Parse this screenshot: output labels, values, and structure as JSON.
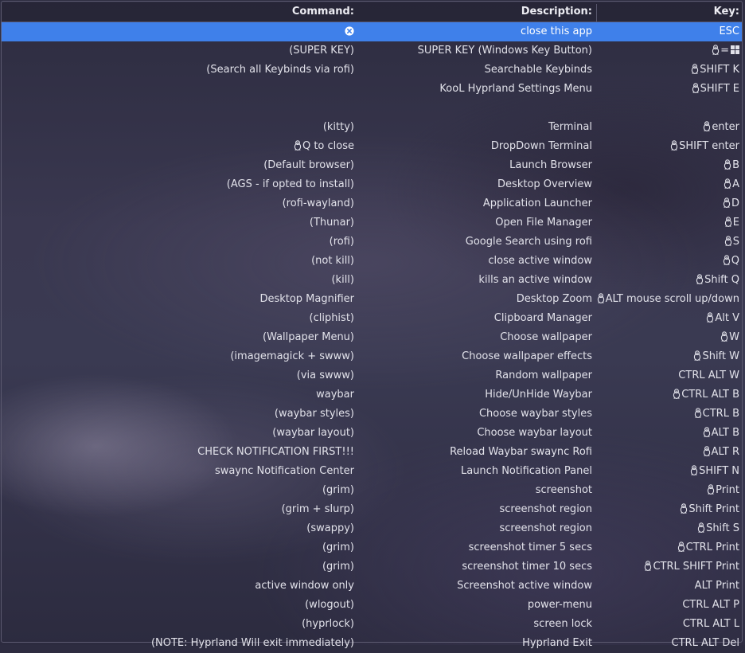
{
  "header": {
    "command": "Command:",
    "description": "Description:",
    "key": "Key:"
  },
  "rows": [
    {
      "cmd": "",
      "cmd_icon": "close-circle-icon",
      "desc": "close this app",
      "key": "ESC",
      "key_icon": "",
      "selected": true
    },
    {
      "cmd": "(SUPER KEY)",
      "desc": "SUPER KEY (Windows Key Button)",
      "key": "=",
      "key_icon": "tux-penguin-icon",
      "key_suffix_icon": "windows-logo-icon"
    },
    {
      "cmd": "(Search all Keybinds via rofi)",
      "desc": "Searchable Keybinds",
      "key": "SHIFT K",
      "key_icon": "tux-penguin-icon"
    },
    {
      "cmd": "",
      "desc": "KooL Hyprland Settings Menu",
      "key": "SHIFT E",
      "key_icon": "tux-penguin-icon"
    },
    {
      "cmd": "",
      "desc": "",
      "key": "",
      "key_icon": ""
    },
    {
      "cmd": "(kitty)",
      "desc": "Terminal",
      "key": "enter",
      "key_icon": "tux-penguin-icon"
    },
    {
      "cmd": "Q to close",
      "cmd_icon": "tux-penguin-icon",
      "desc": "DropDown Terminal",
      "key": "SHIFT enter",
      "key_icon": "tux-penguin-icon"
    },
    {
      "cmd": "(Default browser)",
      "desc": "Launch Browser",
      "key": "B",
      "key_icon": "tux-penguin-icon"
    },
    {
      "cmd": "(AGS - if opted to install)",
      "desc": "Desktop Overview",
      "key": "A",
      "key_icon": "tux-penguin-icon"
    },
    {
      "cmd": "(rofi-wayland)",
      "desc": "Application Launcher",
      "key": "D",
      "key_icon": "tux-penguin-icon"
    },
    {
      "cmd": "(Thunar)",
      "desc": "Open File Manager",
      "key": "E",
      "key_icon": "tux-penguin-icon"
    },
    {
      "cmd": "(rofi)",
      "desc": "Google Search using rofi",
      "key": "S",
      "key_icon": "tux-penguin-icon"
    },
    {
      "cmd": "(not kill)",
      "desc": "close active window",
      "key": "Q",
      "key_icon": "tux-penguin-icon"
    },
    {
      "cmd": "(kill)",
      "desc": "kills an active window",
      "key": "Shift Q ",
      "key_icon": "tux-penguin-icon"
    },
    {
      "cmd": "Desktop Magnifier",
      "desc": "Desktop Zoom",
      "key": "ALT mouse scroll up/down ",
      "key_icon": "tux-penguin-icon"
    },
    {
      "cmd": "(cliphist)",
      "desc": "Clipboard Manager",
      "key": "Alt V",
      "key_icon": "tux-penguin-icon"
    },
    {
      "cmd": "(Wallpaper Menu)",
      "desc": "Choose wallpaper",
      "key": "W",
      "key_icon": "tux-penguin-icon"
    },
    {
      "cmd": "(imagemagick + swww)",
      "desc": "Choose wallpaper effects",
      "key": "Shift W",
      "key_icon": "tux-penguin-icon"
    },
    {
      "cmd": "(via swww)",
      "desc": "Random wallpaper",
      "key": "CTRL ALT W",
      "key_icon": ""
    },
    {
      "cmd": "waybar",
      "desc": "Hide/UnHide Waybar",
      "key": "CTRL ALT B",
      "key_icon": "tux-penguin-icon"
    },
    {
      "cmd": "(waybar styles)",
      "desc": "Choose waybar styles",
      "key": "CTRL B",
      "key_icon": "tux-penguin-icon"
    },
    {
      "cmd": "(waybar layout)",
      "desc": "Choose waybar layout",
      "key": "ALT B",
      "key_icon": "tux-penguin-icon"
    },
    {
      "cmd": "CHECK NOTIFICATION FIRST!!!",
      "desc": "Reload Waybar swaync Rofi",
      "key": "ALT R",
      "key_icon": "tux-penguin-icon"
    },
    {
      "cmd": "swaync Notification Center",
      "desc": "Launch Notification Panel",
      "key": "SHIFT N",
      "key_icon": "tux-penguin-icon"
    },
    {
      "cmd": "(grim)",
      "desc": "screenshot",
      "key": "Print",
      "key_icon": "tux-penguin-icon"
    },
    {
      "cmd": "(grim + slurp)",
      "desc": "screenshot region",
      "key": "Shift Print",
      "key_icon": "tux-penguin-icon"
    },
    {
      "cmd": "(swappy)",
      "desc": "screenshot region",
      "key": "Shift S",
      "key_icon": "tux-penguin-icon"
    },
    {
      "cmd": "(grim)",
      "desc": "screenshot timer 5 secs ",
      "key": "CTRL Print",
      "key_icon": "tux-penguin-icon"
    },
    {
      "cmd": "(grim)",
      "desc": "screenshot timer 10 secs",
      "key": "CTRL SHIFT Print",
      "key_icon": "tux-penguin-icon"
    },
    {
      "cmd": "active window only",
      "desc": "Screenshot active window",
      "key": "ALT Print",
      "key_icon": ""
    },
    {
      "cmd": "(wlogout)",
      "desc": "power-menu",
      "key": "CTRL ALT P",
      "key_icon": ""
    },
    {
      "cmd": "(hyprlock)",
      "desc": "screen lock",
      "key": "CTRL ALT L",
      "key_icon": ""
    },
    {
      "cmd": "(NOTE: Hyprland Will exit immediately)",
      "desc": "Hyprland Exit",
      "key": "CTRL ALT Del",
      "key_icon": ""
    }
  ],
  "colors": {
    "selection": "#3f80ea",
    "text": "#e2e2ea",
    "header_text": "#ececf2"
  }
}
